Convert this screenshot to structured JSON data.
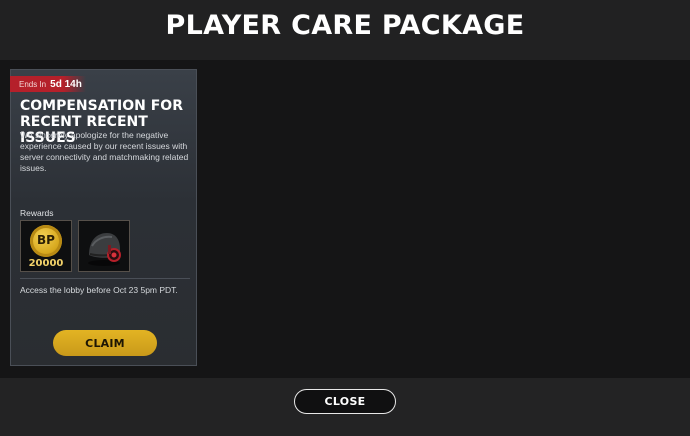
{
  "header": {
    "title": "PLAYER CARE PACKAGE"
  },
  "card": {
    "timer_prefix": "Ends In",
    "timer_value": "5d 14h",
    "title": "COMPENSATION FOR RECENT RECENT ISSUES",
    "description": "We sincerely apologize for the negative experience caused by our recent issues with server connectivity and matchmaking related issues.",
    "rewards_label": "Rewards",
    "rewards": [
      {
        "icon": "bp-coin-icon",
        "coin_label": "BP",
        "amount": "20000"
      },
      {
        "icon": "helmet-icon"
      }
    ],
    "access_note": "Access the lobby before Oct 23 5pm PDT.",
    "claim_label": "CLAIM"
  },
  "footer": {
    "close_label": "CLOSE"
  },
  "colors": {
    "accent_gold": "#d9a81f",
    "timer_red": "#b5202a",
    "background": "#1b1b1c"
  }
}
